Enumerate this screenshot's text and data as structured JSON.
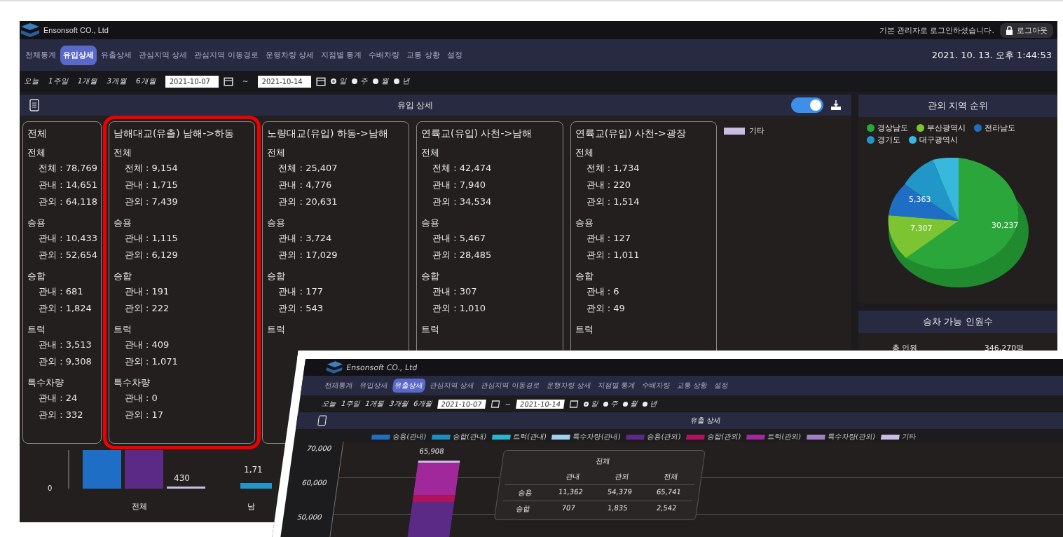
{
  "header": {
    "company": "Ensonsoft CO., Ltd",
    "login_message": "기본 관리자로 로그인하셨습니다.",
    "logout_button": "로그아웃"
  },
  "nav": {
    "tabs": [
      {
        "label": "전체통계",
        "selected": false
      },
      {
        "label": "유입상세",
        "selected": true
      },
      {
        "label": "유출상세",
        "selected": false
      },
      {
        "label": "관심지역 상세",
        "selected": false
      },
      {
        "label": "관심지역 이동경로",
        "selected": false
      },
      {
        "label": "운행차량 상세",
        "selected": false
      },
      {
        "label": "지점별 통계",
        "selected": false
      },
      {
        "label": "수배차량",
        "selected": false
      },
      {
        "label": "교통 상황",
        "selected": false
      },
      {
        "label": "설정",
        "selected": false
      }
    ],
    "datetime": "2021. 10. 13. 오후 1:44:53"
  },
  "filter": {
    "ranges": [
      "오늘",
      "1주일",
      "1개월",
      "3개월",
      "6개월"
    ],
    "start_date": "2021-10-07",
    "separator": "~",
    "end_date": "2021-10-14",
    "units": [
      {
        "label": "일",
        "selected": true
      },
      {
        "label": "주",
        "selected": false
      },
      {
        "label": "월",
        "selected": false
      },
      {
        "label": "년",
        "selected": false
      }
    ]
  },
  "panel": {
    "title": "유입 상세",
    "toggle_on": true,
    "cards": [
      {
        "title": "전체",
        "highlighted": false,
        "sections": [
          {
            "heading": "전체",
            "lines": [
              "전체 : 78,769",
              "관내 : 14,651",
              "관외 : 64,118"
            ]
          },
          {
            "heading": "승용",
            "lines": [
              "관내 : 10,433",
              "관외 : 52,654"
            ]
          },
          {
            "heading": "승합",
            "lines": [
              "관내 : 681",
              "관외 : 1,824"
            ]
          },
          {
            "heading": "트럭",
            "lines": [
              "관내 : 3,513",
              "관외 : 9,308"
            ]
          },
          {
            "heading": "특수차량",
            "lines": [
              "관내 : 24",
              "관외 : 332"
            ]
          }
        ]
      },
      {
        "title": "남해대교(유출) 남해->하동",
        "highlighted": true,
        "sections": [
          {
            "heading": "전체",
            "lines": [
              "전체 : 9,154",
              "관내 : 1,715",
              "관외 : 7,439"
            ]
          },
          {
            "heading": "승용",
            "lines": [
              "관내 : 1,115",
              "관외 : 6,129"
            ]
          },
          {
            "heading": "승합",
            "lines": [
              "관내 : 191",
              "관외 : 222"
            ]
          },
          {
            "heading": "트럭",
            "lines": [
              "관내 : 409",
              "관외 : 1,071"
            ]
          },
          {
            "heading": "특수차량",
            "lines": [
              "관내 : 0",
              "관외 : 17"
            ]
          }
        ]
      },
      {
        "title": "노량대교(유입) 하동->남해",
        "highlighted": false,
        "sections": [
          {
            "heading": "전체",
            "lines": [
              "전체 : 25,407",
              "관내 : 4,776",
              "관외 : 20,631"
            ]
          },
          {
            "heading": "승용",
            "lines": [
              "관내 : 3,724",
              "관외 : 17,029"
            ]
          },
          {
            "heading": "승합",
            "lines": [
              "관내 : 177",
              "관외 : 543"
            ]
          },
          {
            "heading": "트럭"
          }
        ]
      },
      {
        "title": "연륙교(유입) 사천->남해",
        "highlighted": false,
        "sections": [
          {
            "heading": "전체",
            "lines": [
              "전체 : 42,474",
              "관내 : 7,940",
              "관외 : 34,534"
            ]
          },
          {
            "heading": "승용",
            "lines": [
              "관내 : 5,467",
              "관외 : 28,485"
            ]
          },
          {
            "heading": "승합",
            "lines": [
              "관내 : 307",
              "관외 : 1,010"
            ]
          },
          {
            "heading": "트럭"
          }
        ]
      },
      {
        "title": "연륙교(유입) 사천->광장",
        "highlighted": false,
        "sections": [
          {
            "heading": "전체",
            "lines": [
              "전체 : 1,734",
              "관내 : 220",
              "관외 : 1,514"
            ]
          },
          {
            "heading": "승용",
            "lines": [
              "관내 : 127",
              "관외 : 1,011"
            ]
          },
          {
            "heading": "승합",
            "lines": [
              "관내 : 6",
              "관외 : 49"
            ]
          },
          {
            "heading": "트럭"
          }
        ]
      }
    ],
    "legend_label": "기타",
    "chart": {
      "zero_tick": "0",
      "bar_labels": [
        "430",
        "1,71"
      ],
      "categories": [
        "전체",
        "남"
      ]
    }
  },
  "region_rank": {
    "title": "관외 지역 순위",
    "legend": [
      {
        "label": "경상남도",
        "color": "#2aa63a"
      },
      {
        "label": "부산광역시",
        "color": "#7cc432"
      },
      {
        "label": "전라남도",
        "color": "#1d6ec4"
      },
      {
        "label": "경기도",
        "color": "#2196c8"
      },
      {
        "label": "대구광역시",
        "color": "#37b8dc"
      }
    ],
    "slice_labels": [
      "30,237",
      "7,307",
      "5,363"
    ]
  },
  "capacity": {
    "title": "승차 가능 인원수",
    "rows": [
      {
        "label": "총 인원",
        "value": "346,270명"
      }
    ]
  },
  "inset": {
    "company": "Ensonsoft CO., Ltd",
    "tabs": [
      {
        "label": "전체통계",
        "selected": false
      },
      {
        "label": "유입상세",
        "selected": false
      },
      {
        "label": "유출상세",
        "selected": true
      },
      {
        "label": "관심지역 상세",
        "selected": false
      },
      {
        "label": "관심지역 이동경로",
        "selected": false
      },
      {
        "label": "운행차량 상세",
        "selected": false
      },
      {
        "label": "지점별 통계",
        "selected": false
      },
      {
        "label": "수배차량",
        "selected": false
      },
      {
        "label": "교통 상황",
        "selected": false
      },
      {
        "label": "설정",
        "selected": false
      }
    ],
    "ranges": [
      "오늘",
      "1주일",
      "1개월",
      "3개월",
      "6개월"
    ],
    "start_date": "2021-10-07",
    "separator": "~",
    "end_date": "2021-10-14",
    "units": [
      {
        "label": "일",
        "selected": true
      },
      {
        "label": "주",
        "selected": false
      },
      {
        "label": "월",
        "selected": false
      },
      {
        "label": "년",
        "selected": false
      }
    ],
    "title": "유출 상세",
    "legend": [
      {
        "label": "승용(관내)",
        "color": "#1f6fc0"
      },
      {
        "label": "승합(관내)",
        "color": "#1b8fc0"
      },
      {
        "label": "트럭(관내)",
        "color": "#2bb5d0"
      },
      {
        "label": "특수차량(관내)",
        "color": "#9fd0f0"
      },
      {
        "label": "승용(관외)",
        "color": "#5b2a86"
      },
      {
        "label": "승합(관외)",
        "color": "#b0135c"
      },
      {
        "label": "트럭(관외)",
        "color": "#a0289a"
      },
      {
        "label": "특수차량(관외)",
        "color": "#a080c0"
      },
      {
        "label": "기타",
        "color": "#c8bde0"
      }
    ],
    "yticks": [
      "70,000",
      "60,000",
      "50,000"
    ],
    "bar_label": "65,908",
    "tooltip": {
      "title": "전체",
      "columns": [
        "관내",
        "관외",
        "전체"
      ],
      "rows": [
        {
          "label": "승용",
          "values": [
            "11,362",
            "54,379",
            "65,741"
          ]
        },
        {
          "label": "승합",
          "values": [
            "707",
            "1,835",
            "2,542"
          ]
        }
      ]
    }
  }
}
